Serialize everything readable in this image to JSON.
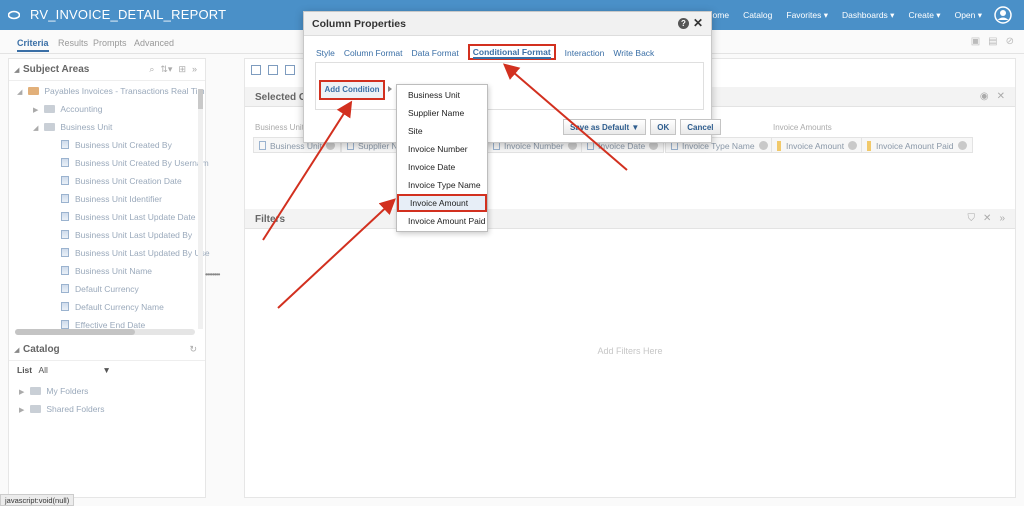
{
  "app": {
    "title": "RV_INVOICE_DETAIL_REPORT",
    "nav": [
      "Home",
      "Catalog",
      "Favorites ▾",
      "Dashboards ▾",
      "Create ▾",
      "Open ▾"
    ]
  },
  "tabs": [
    "Criteria",
    "Results",
    "Prompts",
    "Advanced"
  ],
  "subject_areas": {
    "title": "Subject Areas",
    "root": "Payables Invoices - Transactions Real Tim",
    "folders": [
      "Accounting",
      "Business Unit"
    ],
    "columns": [
      "Business Unit Created By",
      "Business Unit Created By Usernam",
      "Business Unit Creation Date",
      "Business Unit Identifier",
      "Business Unit Last Update Date",
      "Business Unit Last Updated By",
      "Business Unit Last Updated By Use",
      "Business Unit Name",
      "Default Currency",
      "Default Currency Name",
      "Effective End Date"
    ]
  },
  "catalog": {
    "title": "Catalog",
    "list_label": "List",
    "list_value": "All",
    "folders": [
      "My Folders",
      "Shared Folders"
    ]
  },
  "selected_columns": {
    "title": "Selected C",
    "headers": [
      "Business Unit",
      "Invoice Amounts"
    ],
    "chips": [
      "Business Unit",
      "Supplier Na",
      "Invoice Number",
      "Invoice Date",
      "Invoice Type Name",
      "Invoice Amount",
      "Invoice Amount Paid"
    ]
  },
  "filters": {
    "title": "Filters",
    "placeholder": "Add Filters Here"
  },
  "dialog": {
    "title": "Column Properties",
    "help": "?",
    "close": "✕",
    "tabs": [
      "Style",
      "Column Format",
      "Data Format",
      "Conditional Format",
      "Interaction",
      "Write Back"
    ],
    "active_tab": "Conditional Format",
    "add_condition": "Add Condition",
    "buttons": [
      "Save as Default ▼",
      "OK",
      "Cancel"
    ]
  },
  "dropdown": {
    "items": [
      "Business Unit",
      "Supplier Name",
      "Site",
      "Invoice Number",
      "Invoice Date",
      "Invoice Type Name",
      "Invoice Amount",
      "Invoice Amount Paid"
    ],
    "highlighted": "Invoice Amount"
  },
  "status_bar": "javascript:void(null)",
  "colors": {
    "topbar": "#4a90c8",
    "annotation": "#d2301f",
    "link": "#3a6fa6"
  }
}
